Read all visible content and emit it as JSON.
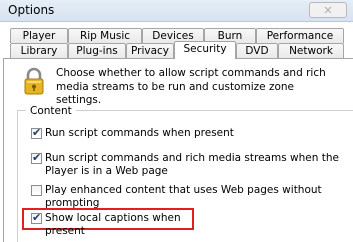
{
  "window": {
    "title": "Options",
    "close_label": "✕"
  },
  "tabs_row1": [
    "Player",
    "Rip Music",
    "Devices",
    "Burn",
    "Performance"
  ],
  "tabs_row2": [
    "Library",
    "Plug-ins",
    "Privacy",
    "Security",
    "DVD",
    "Network"
  ],
  "active_tab": "Security",
  "intro_text": "Choose whether to allow script commands and rich media streams to be run and customize zone settings.",
  "content_group": {
    "label": "Content",
    "options": [
      {
        "label": "Run script commands when present",
        "checked": true
      },
      {
        "label": "Run script commands and rich media streams when the Player is in a Web page",
        "checked": true
      },
      {
        "label": "Play enhanced content that uses Web pages without prompting",
        "checked": false
      },
      {
        "label": "Show local captions when present",
        "checked": true
      }
    ]
  },
  "colors": {
    "highlight": "#e02020"
  },
  "icons": {
    "lock": "lock-icon"
  }
}
